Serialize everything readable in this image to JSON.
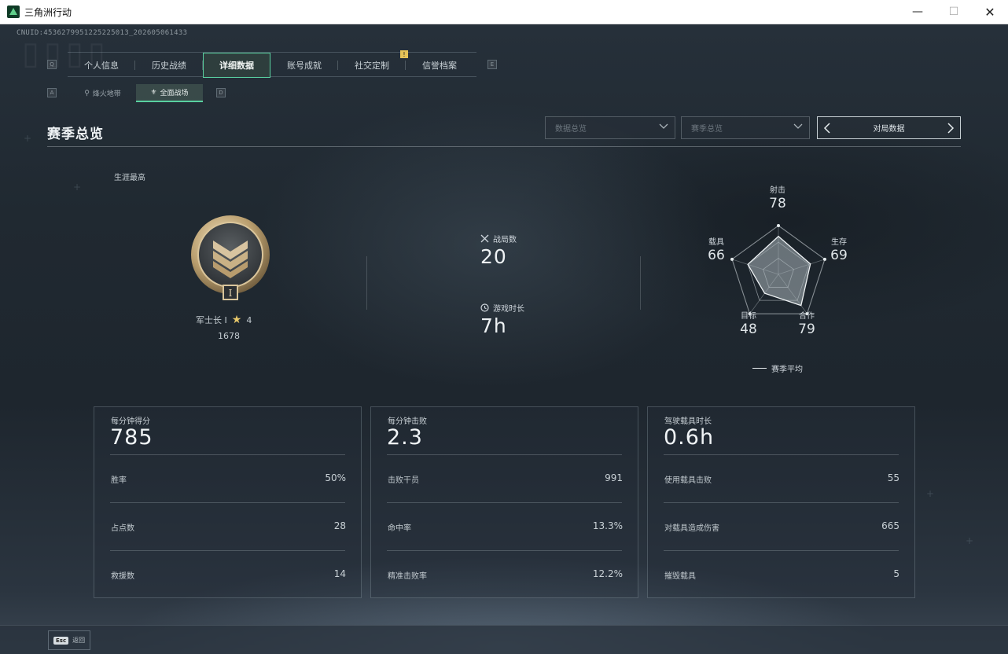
{
  "window": {
    "title": "三角洲行动",
    "minimize": "—",
    "maximize": "☐",
    "close": "✕"
  },
  "uid": "CNUID:4536279951225225013_202605061433",
  "main_tabs": [
    {
      "label": "个人信息",
      "active": false
    },
    {
      "label": "历史战绩",
      "active": false
    },
    {
      "label": "详细数据",
      "active": true
    },
    {
      "label": "账号成就",
      "active": false
    },
    {
      "label": "社交定制",
      "active": false
    },
    {
      "label": "信誉档案",
      "active": false
    }
  ],
  "key_hints": {
    "tabs_left": "Q",
    "tabs_right": "E",
    "sub_left": "A",
    "sub_right": "D"
  },
  "notice_badge": "!",
  "sub_tabs": [
    {
      "label": "烽火地带",
      "active": false
    },
    {
      "label": "全面战场",
      "active": true
    }
  ],
  "section": {
    "title": "赛季总览",
    "dropdown1": "数据总览",
    "dropdown2": "赛季总览",
    "switcher_label": "对局数据"
  },
  "career": {
    "label": "生涯最高",
    "rank_name": "军士长 I",
    "stars": "4",
    "score": "1678",
    "medal_numeral": "I"
  },
  "summary": {
    "battles_label": "战局数",
    "battles_value": "20",
    "time_label": "游戏时长",
    "time_value": "7h"
  },
  "radar": {
    "axes": [
      {
        "label": "射击",
        "value": 78
      },
      {
        "label": "生存",
        "value": 69
      },
      {
        "label": "合作",
        "value": 79
      },
      {
        "label": "目标",
        "value": 48
      },
      {
        "label": "载具",
        "value": 66
      }
    ],
    "legend": "赛季平均",
    "max": 100
  },
  "cards": [
    {
      "label": "每分钟得分",
      "value": "785",
      "rows": [
        {
          "label": "胜率",
          "value": "50%"
        },
        {
          "label": "占点数",
          "value": "28"
        },
        {
          "label": "救援数",
          "value": "14"
        }
      ]
    },
    {
      "label": "每分钟击败",
      "value": "2.3",
      "rows": [
        {
          "label": "击败干员",
          "value": "991"
        },
        {
          "label": "命中率",
          "value": "13.3%"
        },
        {
          "label": "精准击败率",
          "value": "12.2%"
        }
      ]
    },
    {
      "label": "驾驶载具时长",
      "value": "0.6h",
      "rows": [
        {
          "label": "使用载具击败",
          "value": "55"
        },
        {
          "label": "对载具造成伤害",
          "value": "665"
        },
        {
          "label": "摧毁载具",
          "value": "5"
        }
      ]
    }
  ],
  "bottom": {
    "esc": "Esc",
    "back": "返回"
  },
  "colors": {
    "accent": "#59d0a0",
    "gold": "#e8c86a"
  }
}
